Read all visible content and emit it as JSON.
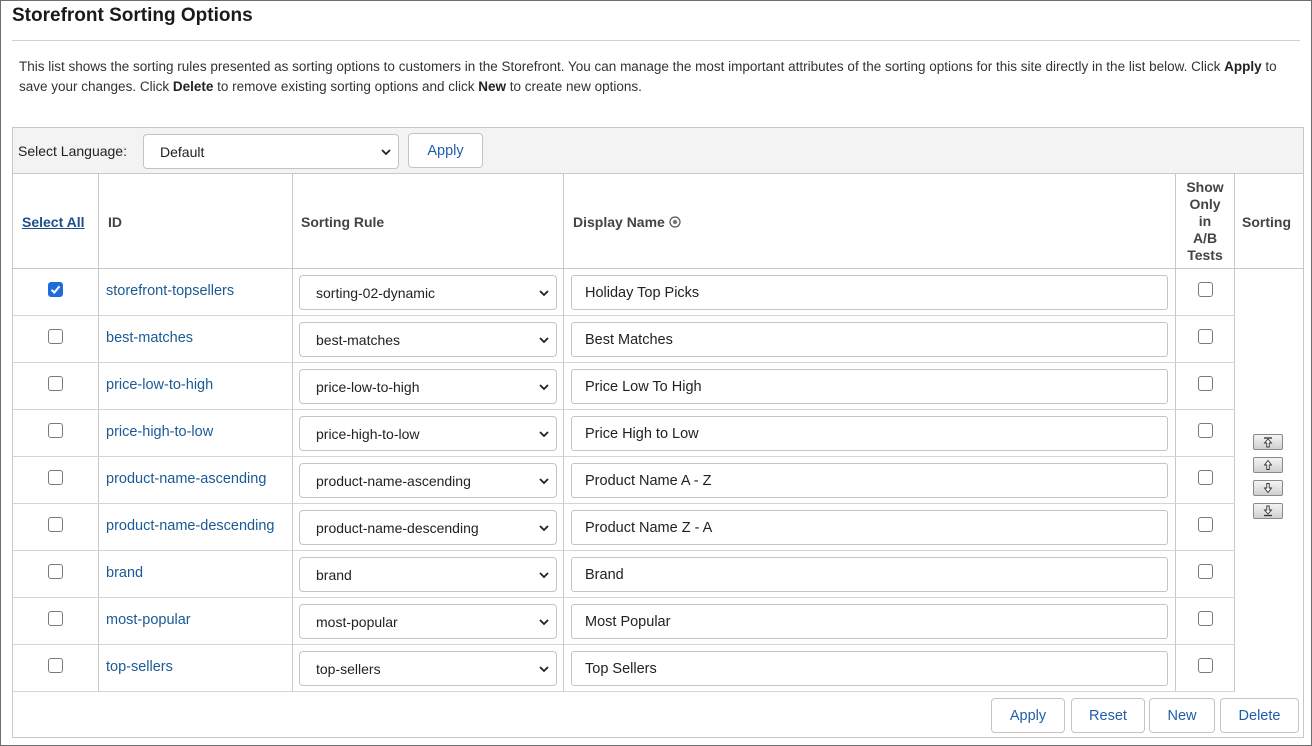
{
  "page": {
    "title": "Storefront Sorting Options",
    "description": {
      "part1": "This list shows the sorting rules presented as sorting options to customers in the Storefront. You can manage the most important attributes of the sorting options for this site directly in the list below. Click ",
      "apply_word": "Apply",
      "part2": " to save your changes. Click ",
      "delete_word": "Delete",
      "part3": " to remove existing sorting options and click ",
      "new_word": "New",
      "part4": " to create new options."
    }
  },
  "language_bar": {
    "label": "Select Language:",
    "selected": "Default",
    "apply_label": "Apply"
  },
  "table": {
    "headers": {
      "select_all": "Select All",
      "id": "ID",
      "sorting_rule": "Sorting Rule",
      "display_name": "Display Name",
      "ab_line1": "Show",
      "ab_line2": "Only",
      "ab_line3": "in",
      "ab_line4": "A/B",
      "ab_line5": "Tests",
      "sorting": "Sorting"
    },
    "rows": [
      {
        "selected": true,
        "id": "storefront-topsellers",
        "rule": "sorting-02-dynamic",
        "display_name": "Holiday Top Picks",
        "ab_only": false
      },
      {
        "selected": false,
        "id": "best-matches",
        "rule": "best-matches",
        "display_name": "Best Matches",
        "ab_only": false
      },
      {
        "selected": false,
        "id": "price-low-to-high",
        "rule": "price-low-to-high",
        "display_name": "Price Low To High",
        "ab_only": false
      },
      {
        "selected": false,
        "id": "price-high-to-low",
        "rule": "price-high-to-low",
        "display_name": "Price High to Low",
        "ab_only": false
      },
      {
        "selected": false,
        "id": "product-name-ascending",
        "rule": "product-name-ascending",
        "display_name": "Product Name A - Z",
        "ab_only": false
      },
      {
        "selected": false,
        "id": "product-name-descending",
        "rule": "product-name-descending",
        "display_name": "Product Name Z - A",
        "ab_only": false
      },
      {
        "selected": false,
        "id": "brand",
        "rule": "brand",
        "display_name": "Brand",
        "ab_only": false
      },
      {
        "selected": false,
        "id": "most-popular",
        "rule": "most-popular",
        "display_name": "Most Popular",
        "ab_only": false
      },
      {
        "selected": false,
        "id": "top-sellers",
        "rule": "top-sellers",
        "display_name": "Top Sellers",
        "ab_only": false
      }
    ]
  },
  "sorting_controls": [
    "move-top-icon",
    "move-up-icon",
    "move-down-icon",
    "move-bottom-icon"
  ],
  "footer_buttons": {
    "apply": "Apply",
    "reset": "Reset",
    "new": "New",
    "delete": "Delete"
  },
  "colors": {
    "link": "#1a5a96",
    "button_text": "#1f5fa8",
    "checkbox_checked": "#1c6cd9",
    "bar_background": "#f3f3f3"
  }
}
